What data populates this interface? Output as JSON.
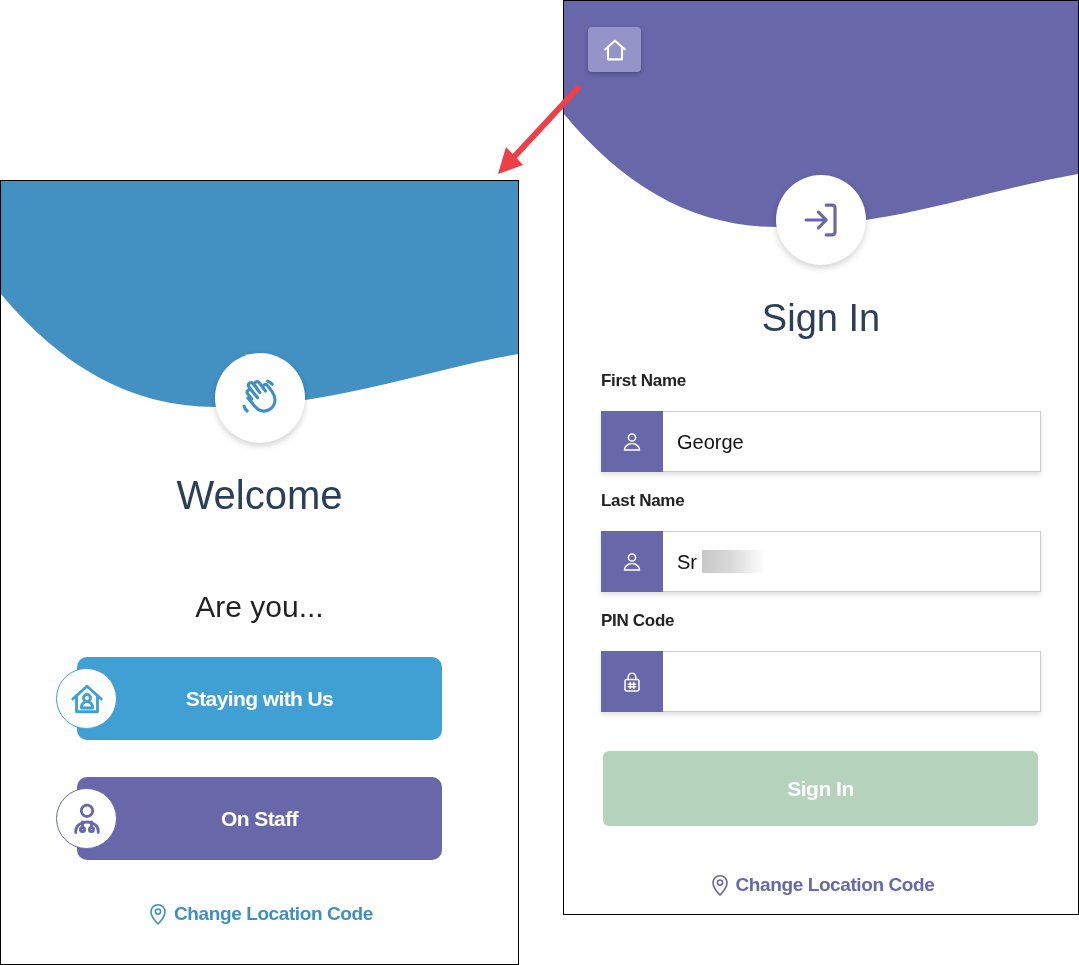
{
  "welcome_screen": {
    "title": "Welcome",
    "prompt": "Are you...",
    "options": [
      {
        "kind": "guest",
        "label": "Staying with Us"
      },
      {
        "kind": "staff",
        "label": "On Staff"
      }
    ],
    "link": "Change Location Code"
  },
  "sign_in_screen": {
    "title": "Sign In",
    "fields": [
      {
        "kind": "person",
        "label": "First Name",
        "value": "George",
        "redacted": false
      },
      {
        "kind": "person",
        "label": "Last Name",
        "value": "Sr",
        "redacted": true
      },
      {
        "kind": "pin",
        "label": "PIN Code",
        "redacted": false
      }
    ],
    "submit": {
      "label": "Sign In",
      "disabled": true
    },
    "link": "Change Location Code"
  },
  "annotations": [
    {
      "kind": "arrow"
    }
  ]
}
